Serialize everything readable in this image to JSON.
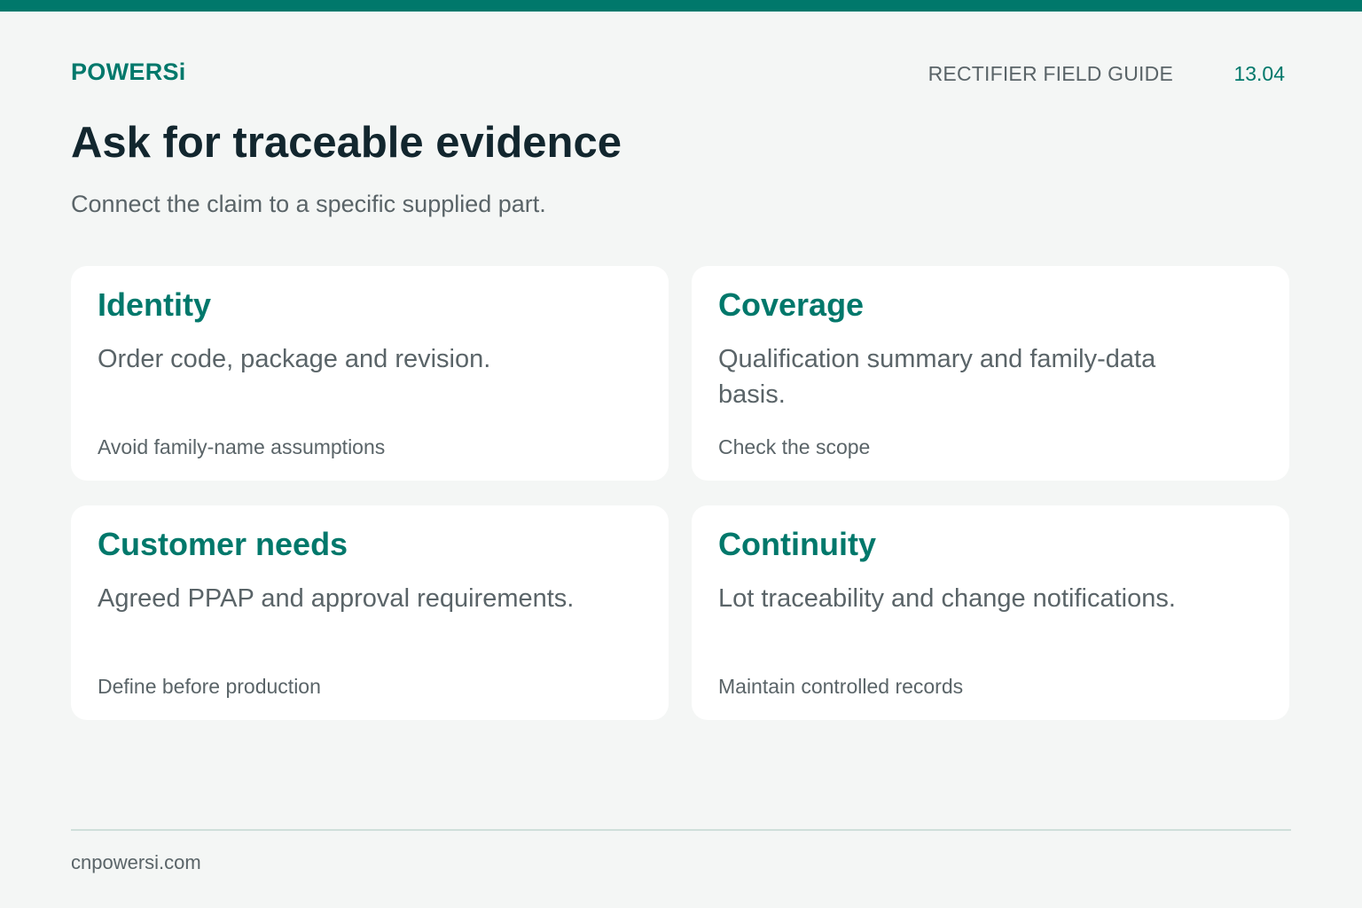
{
  "header": {
    "brand": "POWERSi",
    "guide_label": "RECTIFIER FIELD GUIDE",
    "page_number": "13.04"
  },
  "main": {
    "title": "Ask for traceable evidence",
    "subtitle": "Connect the claim to a specific supplied part."
  },
  "cards": [
    {
      "title": "Identity",
      "body": "Order code, package and revision.",
      "note": "Avoid family-name assumptions"
    },
    {
      "title": "Coverage",
      "body": "Qualification summary and family-data basis.",
      "note": "Check the scope"
    },
    {
      "title": "Customer needs",
      "body": "Agreed PPAP and approval requirements.",
      "note": "Define before production"
    },
    {
      "title": "Continuity",
      "body": "Lot traceability and change notifications.",
      "note": "Maintain controlled records"
    }
  ],
  "footer": {
    "url": "cnpowersi.com"
  },
  "colors": {
    "accent": "#00786b",
    "background": "#f4f6f5",
    "card": "#ffffff",
    "title": "#12262e",
    "text": "#5a6468"
  }
}
